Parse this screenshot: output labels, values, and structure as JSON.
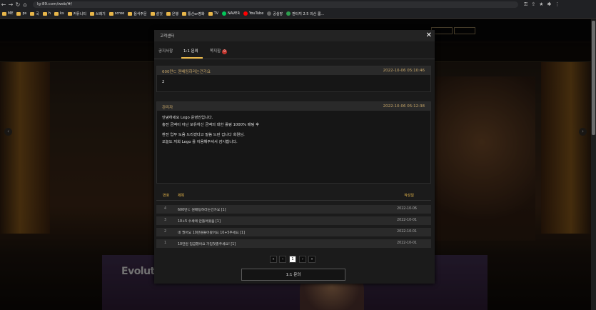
{
  "browser": {
    "url": "lg-89.com/web/#/",
    "bookmarks": [
      {
        "label": "ME",
        "type": "folder"
      },
      {
        "label": "ps",
        "type": "folder"
      },
      {
        "label": "국",
        "type": "folder"
      },
      {
        "label": "h",
        "type": "folder"
      },
      {
        "label": "ks",
        "type": "folder"
      },
      {
        "label": "커뮤니티",
        "type": "folder"
      },
      {
        "label": "쓰레기",
        "type": "folder"
      },
      {
        "label": "scree",
        "type": "folder"
      },
      {
        "label": "음식주문",
        "type": "folder"
      },
      {
        "label": "살것",
        "type": "folder"
      },
      {
        "label": "은행",
        "type": "folder"
      },
      {
        "label": "통신or영화",
        "type": "folder"
      },
      {
        "label": "TV",
        "type": "folder"
      },
      {
        "label": "NAVER",
        "type": "site",
        "color": "#03c75a"
      },
      {
        "label": "YouTube",
        "type": "site",
        "color": "#ff0000"
      },
      {
        "label": "공실장",
        "type": "site",
        "color": "#666666"
      },
      {
        "label": "판타지 2.5 의산 룸...",
        "type": "site",
        "color": "#2e9e4e"
      }
    ]
  },
  "site": {
    "brand_text": "Evolution"
  },
  "modal": {
    "title": "고객센터",
    "close_symbol": "✕",
    "tabs": [
      {
        "label": "공지사항",
        "active": false
      },
      {
        "label": "1:1 문의",
        "active": true
      },
      {
        "label": "쪽지함",
        "active": false,
        "badge": "0"
      }
    ],
    "question": {
      "title": "600만ㄷ 원배팅하라는건가요",
      "date": "2022-10-06 05:10:46",
      "body": "2"
    },
    "answer": {
      "author": "관리자",
      "date": "2022-10-06 05:12:38",
      "lines": [
        "안녕하세요 Lego 운영진입니다.",
        "충전 금액이 아닌 보유하신 금액의 대한 롤링 1000% 배팅 후",
        "",
        "환전 업무 도움 드리겠다고 말씀 드린 겁니다 회원님.",
        "오늘도 저희 Lego 를 이용해주셔서 감사합니다."
      ]
    },
    "list_headers": {
      "num": "번호",
      "subject": "제목",
      "date": "작성일"
    },
    "rows": [
      {
        "num": "4",
        "subject": "600만ㄷ 원배팅하라는건가요 [1]",
        "date": "2022-10-06"
      },
      {
        "num": "3",
        "subject": "10+5 수세에 안들어왔음 [1]",
        "date": "2022-10-01"
      },
      {
        "num": "2",
        "subject": "네 꿨어요 10만원들어왔어요 10+5주세요 [1]",
        "date": "2022-10-01"
      },
      {
        "num": "1",
        "subject": "10만원 입금했어요 가입첫충주세요! [1]",
        "date": "2022-10-01"
      }
    ],
    "pagination": {
      "first": "«",
      "prev": "‹",
      "current": "1",
      "next": "›",
      "last": "»"
    },
    "inquiry_button": "1:1 문의"
  },
  "colors": {
    "accent": "#e9b84a",
    "badge": "#c0332b"
  }
}
